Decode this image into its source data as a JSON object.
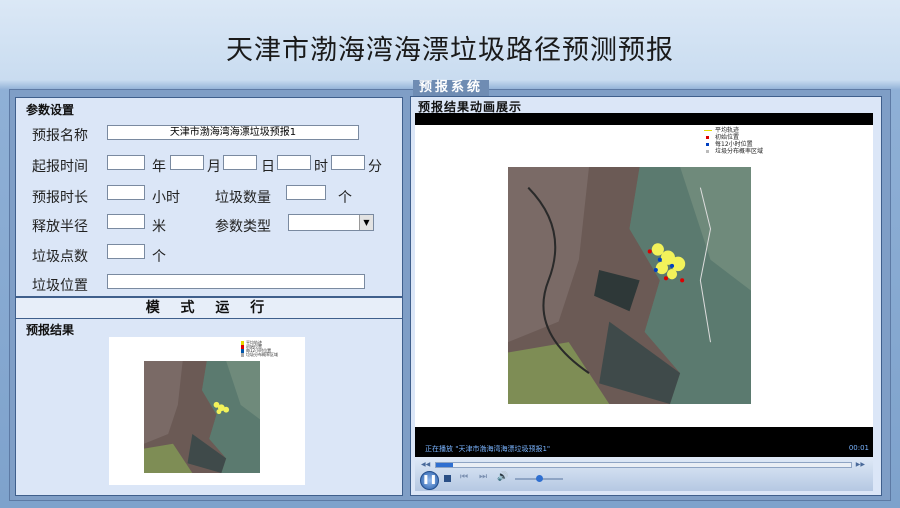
{
  "title": "天津市渤海湾海漂垃圾路径预测预报",
  "system_label": "预报系统",
  "params": {
    "section_title": "参数设置",
    "forecast_name_label": "预报名称",
    "forecast_name_value": "天津市渤海湾海漂垃圾预报1",
    "start_time_label": "起报时间",
    "year": "年",
    "month": "月",
    "day": "日",
    "hour": "时",
    "minute": "分",
    "duration_label": "预报时长",
    "duration_unit": "小时",
    "garbage_count_label": "垃圾数量",
    "count_unit": "个",
    "radius_label": "释放半径",
    "radius_unit": "米",
    "param_type_label": "参数类型",
    "points_label": "垃圾点数",
    "points_unit": "个",
    "position_label": "垃圾位置"
  },
  "run_button": "模 式 运 行",
  "result_title": "预报结果",
  "anim_title": "预报结果动画展示",
  "legend": [
    "平均轨迹",
    "初始位置",
    "每12小时位置",
    "垃圾分布概率区域"
  ],
  "player": {
    "status": "正在播放 \"天津市渤海湾海漂垃圾预报1\"",
    "time": "00:01",
    "progress": 0.04,
    "volume": 0.5
  }
}
